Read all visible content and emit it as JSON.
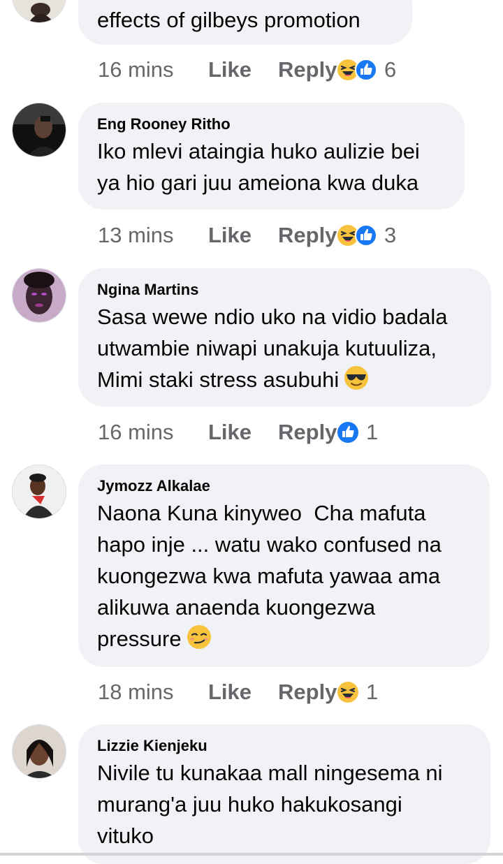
{
  "comments": [
    {
      "author": "",
      "lines": [
        "effects of gilbeys promotion"
      ],
      "time": "16 mins",
      "like": "Like",
      "reply": "Reply",
      "reactions": [
        "haha-icon",
        "like-icon"
      ],
      "reaction_count": "6"
    },
    {
      "author": "Eng Rooney Ritho",
      "lines": [
        "Iko mlevi ataingia huko aulizie bei",
        "ya hio gari juu ameiona kwa duka"
      ],
      "time": "13 mins",
      "like": "Like",
      "reply": "Reply",
      "reactions": [
        "haha-icon",
        "like-icon"
      ],
      "reaction_count": "3"
    },
    {
      "author": "Ngina Martins",
      "lines": [
        "Sasa wewe ndio uko na vidio badala",
        "utwambie niwapi unakuja kutuuliza,",
        "Mimi staki stress asubuhi"
      ],
      "inline_emoji": "sunglasses-emoji",
      "time": "16 mins",
      "like": "Like",
      "reply": "Reply",
      "reactions": [
        "like-icon"
      ],
      "reaction_count": "1"
    },
    {
      "author": "Jymozz Alkalae",
      "lines": [
        "Naona Kuna kinyweo  Cha mafuta",
        "hapo inje ... watu wako confused na",
        "kuongezwa kwa mafuta yawaa ama",
        "alikuwa anaenda kuongezwa",
        "pressure"
      ],
      "inline_emoji": "smirk-emoji",
      "time": "18 mins",
      "like": "Like",
      "reply": "Reply",
      "reactions": [
        "haha-icon"
      ],
      "reaction_count": "1"
    },
    {
      "author": "Lizzie Kienjeku",
      "lines": [
        "Nivile tu kunakaa mall ningesema ni",
        "murang'a juu huko hakukosangi",
        "vituko"
      ]
    }
  ],
  "colors": {
    "bubble": "#f0f2f5",
    "meta_text": "#65676b",
    "like_blue": "#1877f2",
    "haha_yellow": "#f7c23c"
  }
}
